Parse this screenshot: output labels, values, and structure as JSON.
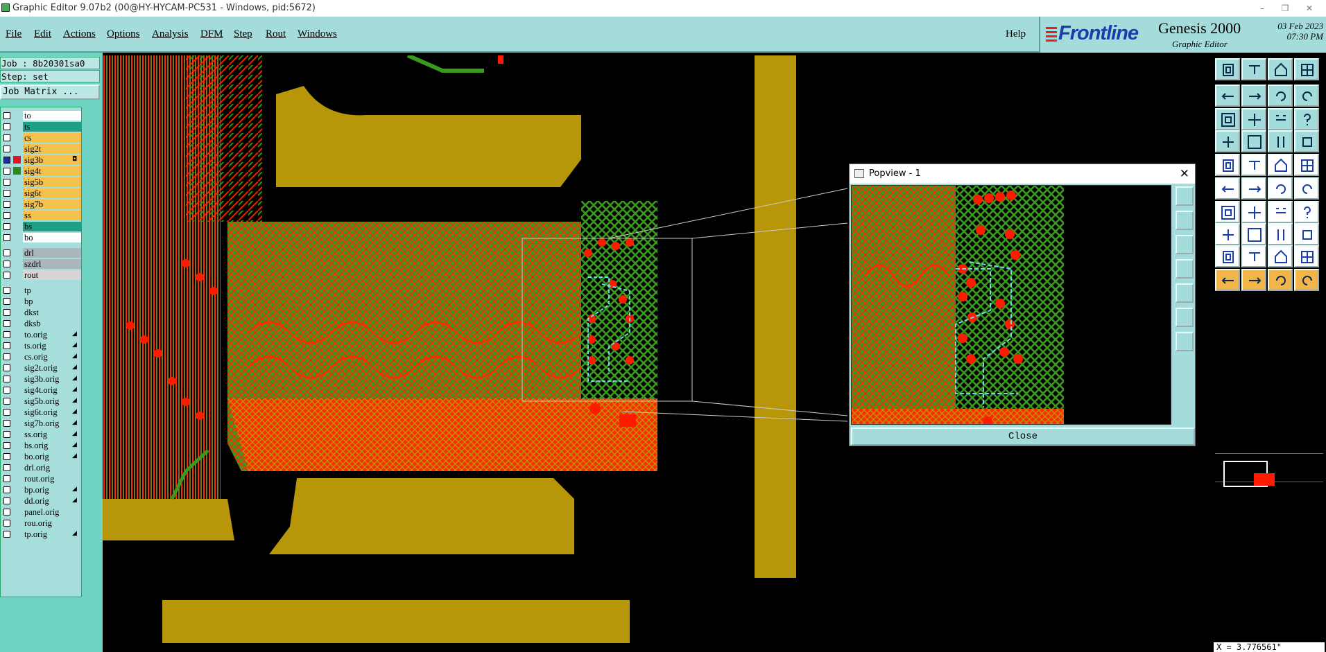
{
  "window": {
    "title": "Graphic Editor 9.07b2 (00@HY-HYCAM-PC531 - Windows, pid:5672)",
    "minimize": "–",
    "maximize": "❐",
    "close": "✕"
  },
  "menu": {
    "items": [
      "File",
      "Edit",
      "Actions",
      "Options",
      "Analysis",
      "DFM",
      "Step",
      "Rout",
      "Windows"
    ],
    "help": "Help"
  },
  "brand": {
    "logo": "Frontline",
    "product": "Genesis 2000",
    "subtitle": "Graphic Editor",
    "date": "03 Feb 2023",
    "time": "07:30 PM"
  },
  "job": {
    "job_label": "Job : 8b20301sa0",
    "step_label": "Step: set",
    "matrix_button": "Job Matrix ..."
  },
  "layers": [
    {
      "name": "to",
      "color": "#ffffff",
      "mark": ""
    },
    {
      "name": "ts",
      "color": "#1f9f86",
      "mark": ""
    },
    {
      "name": "cs",
      "color": "#f5c04c",
      "mark": ""
    },
    {
      "name": "sig2t",
      "color": "#f5c04c",
      "mark": ""
    },
    {
      "name": "sig3b",
      "color": "#f5c04c",
      "mark": "◘"
    },
    {
      "name": "sig4t",
      "color": "#f5c04c",
      "mark": ""
    },
    {
      "name": "sig5b",
      "color": "#f5c04c",
      "mark": ""
    },
    {
      "name": "sig6t",
      "color": "#f5c04c",
      "mark": ""
    },
    {
      "name": "sig7b",
      "color": "#f5c04c",
      "mark": ""
    },
    {
      "name": "ss",
      "color": "#f5c04c",
      "mark": ""
    },
    {
      "name": "bs",
      "color": "#1f9f86",
      "mark": ""
    },
    {
      "name": "bo",
      "color": "#ffffff",
      "mark": ""
    },
    {
      "name": "drl",
      "color": "#a9b7bd",
      "mark": ""
    },
    {
      "name": "szdrl",
      "color": "#a9b7bd",
      "mark": ""
    },
    {
      "name": "rout",
      "color": "#d6d6d6",
      "mark": ""
    },
    {
      "name": "tp",
      "color": "#a6dedb",
      "mark": ""
    },
    {
      "name": "bp",
      "color": "#a6dedb",
      "mark": ""
    },
    {
      "name": "dkst",
      "color": "#a6dedb",
      "mark": ""
    },
    {
      "name": "dksb",
      "color": "#a6dedb",
      "mark": ""
    },
    {
      "name": "to.orig",
      "color": "#a6dedb",
      "mark": "◢"
    },
    {
      "name": "ts.orig",
      "color": "#a6dedb",
      "mark": "◢"
    },
    {
      "name": "cs.orig",
      "color": "#a6dedb",
      "mark": "◢"
    },
    {
      "name": "sig2t.orig",
      "color": "#a6dedb",
      "mark": "◢"
    },
    {
      "name": "sig3b.orig",
      "color": "#a6dedb",
      "mark": "◢"
    },
    {
      "name": "sig4t.orig",
      "color": "#a6dedb",
      "mark": "◢"
    },
    {
      "name": "sig5b.orig",
      "color": "#a6dedb",
      "mark": "◢"
    },
    {
      "name": "sig6t.orig",
      "color": "#a6dedb",
      "mark": "◢"
    },
    {
      "name": "sig7b.orig",
      "color": "#a6dedb",
      "mark": "◢"
    },
    {
      "name": "ss.orig",
      "color": "#a6dedb",
      "mark": "◢"
    },
    {
      "name": "bs.orig",
      "color": "#a6dedb",
      "mark": "◢"
    },
    {
      "name": "bo.orig",
      "color": "#a6dedb",
      "mark": "◢"
    },
    {
      "name": "drl.orig",
      "color": "#a6dedb",
      "mark": ""
    },
    {
      "name": "rout.orig",
      "color": "#a6dedb",
      "mark": ""
    },
    {
      "name": "bp.orig",
      "color": "#a6dedb",
      "mark": "◢"
    },
    {
      "name": "dd.orig",
      "color": "#a6dedb",
      "mark": "◢"
    },
    {
      "name": "panel.orig",
      "color": "#a6dedb",
      "mark": ""
    },
    {
      "name": "rou.orig",
      "color": "#a6dedb",
      "mark": ""
    },
    {
      "name": "tp.orig",
      "color": "#a6dedb",
      "mark": "◢"
    }
  ],
  "popview": {
    "title": "Popview - 1",
    "close_button": "Close",
    "close_x": "✕"
  },
  "status": {
    "coordinate": "X = 3.776561\""
  },
  "colors": {
    "accent": "#a3dcda",
    "panel": "#6fd4c2",
    "copper": "#b8960a",
    "trace_red": "#ff1a00",
    "trace_green": "#3a9a1e",
    "trace_cyan": "#6fd9e8"
  }
}
